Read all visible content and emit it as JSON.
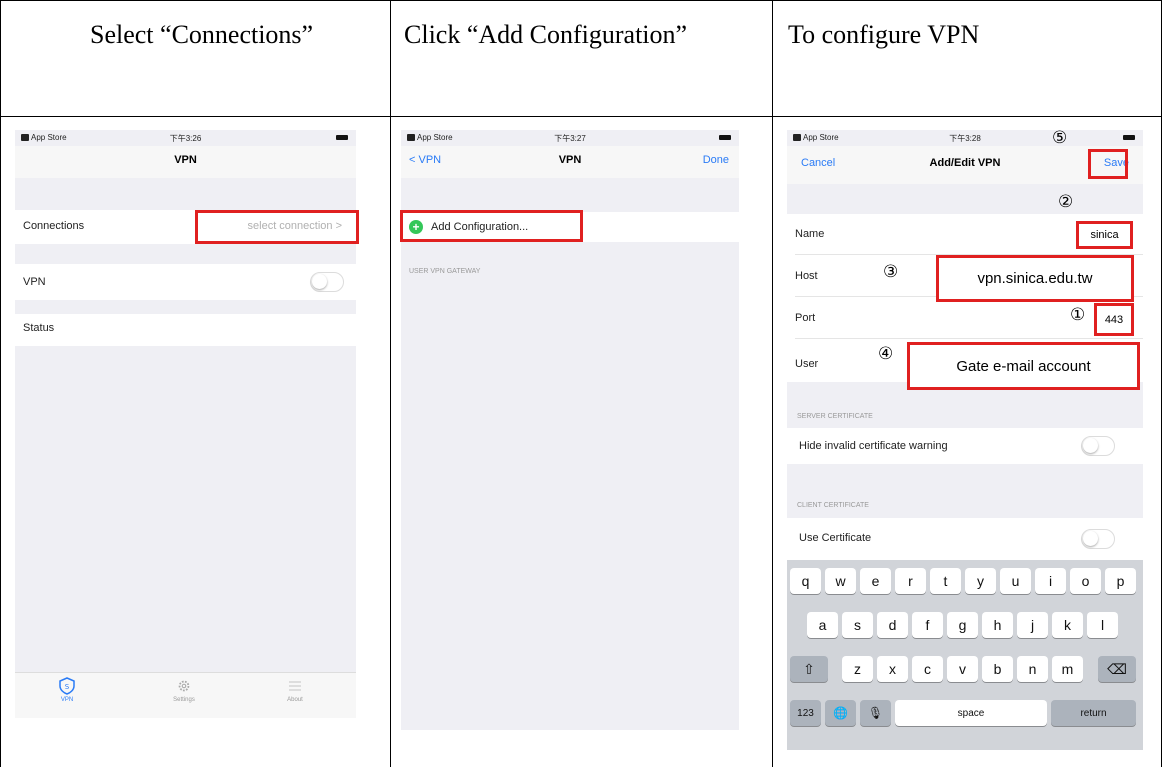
{
  "headers": [
    "Select “Connections”",
    "Click “Add Configuration”",
    "To configure VPN"
  ],
  "phone1": {
    "status": {
      "carrier": "App Store",
      "time": "下午3:26"
    },
    "title": "VPN",
    "connections_label": "Connections",
    "connections_value": "select connection >",
    "vpn_label": "VPN",
    "status_label": "Status",
    "tabs": [
      "VPN",
      "Settings",
      "About"
    ]
  },
  "phone2": {
    "status": {
      "carrier": "App Store",
      "time": "下午3:27"
    },
    "back": "< VPN",
    "title": "VPN",
    "done": "Done",
    "add_config": "Add Configuration...",
    "section": "USER VPN GATEWAY"
  },
  "phone3": {
    "status": {
      "carrier": "App Store",
      "time": "下午3:28"
    },
    "cancel": "Cancel",
    "title": "Add/Edit VPN",
    "save": "Save",
    "fields": [
      {
        "label": "Name",
        "value": "sinica"
      },
      {
        "label": "Host",
        "value": "vpn.sinica.edu.tw"
      },
      {
        "label": "Port",
        "value": "443"
      },
      {
        "label": "User",
        "value": "Gate e-mail account"
      }
    ],
    "server_cert_header": "SERVER CERTIFICATE",
    "hide_invalid": "Hide invalid certificate warning",
    "client_cert_header": "CLIENT CERTIFICATE",
    "use_cert": "Use Certificate",
    "keyboard": {
      "row1": [
        "q",
        "w",
        "e",
        "r",
        "t",
        "y",
        "u",
        "i",
        "o",
        "p"
      ],
      "row2": [
        "a",
        "s",
        "d",
        "f",
        "g",
        "h",
        "j",
        "k",
        "l"
      ],
      "row3": [
        "z",
        "x",
        "c",
        "v",
        "b",
        "n",
        "m"
      ],
      "shift": "⇧",
      "backspace": "⌫",
      "num": "123",
      "globe": "🌐",
      "mic": "🎙",
      "space": "space",
      "return": "return"
    }
  },
  "markers": [
    "①",
    "②",
    "③",
    "④",
    "⑤"
  ],
  "colors": {
    "ios_blue": "#2a7bf6",
    "highlight_red": "#e02020",
    "green_plus": "#34c759"
  }
}
